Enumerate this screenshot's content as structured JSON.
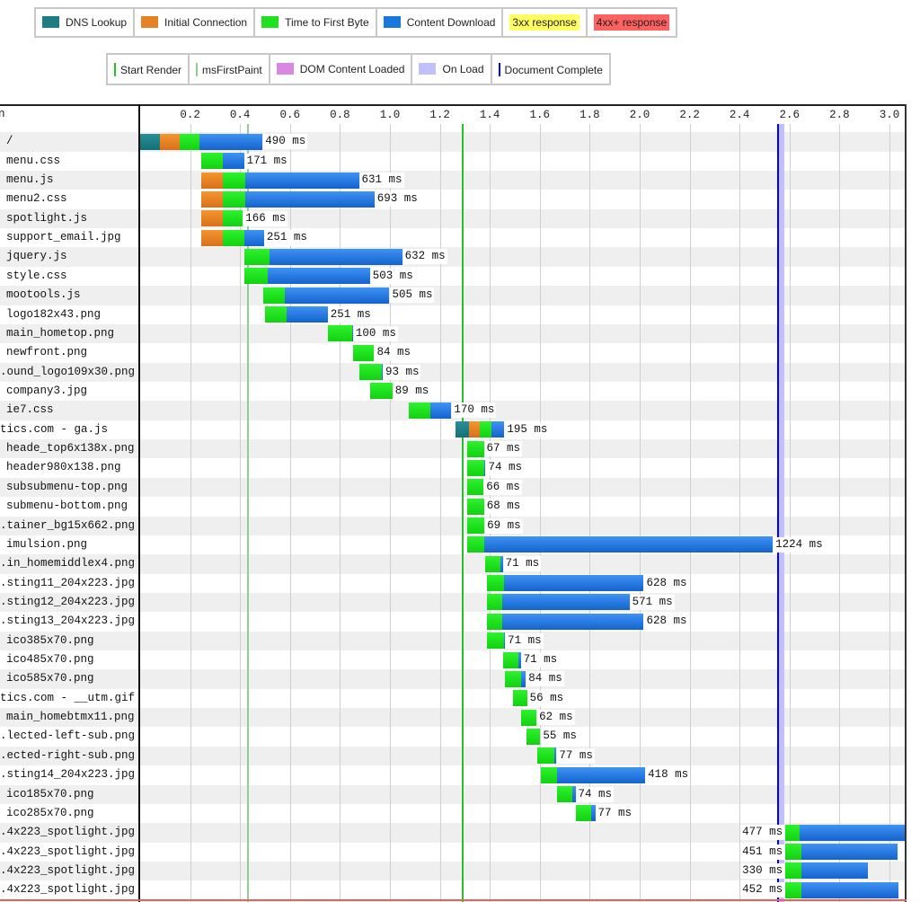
{
  "legend": {
    "request_phases": [
      {
        "label": "DNS Lookup",
        "color": "#1f7c83",
        "style": "swatch"
      },
      {
        "label": "Initial Connection",
        "color": "#e58226",
        "style": "swatch"
      },
      {
        "label": "Time to First Byte",
        "color": "#1fe11f",
        "style": "swatch"
      },
      {
        "label": "Content Download",
        "color": "#1977dd",
        "style": "swatch"
      },
      {
        "label": "3xx response",
        "color": "#ffff60",
        "style": "highlight"
      },
      {
        "label": "4xx+ response",
        "color": "#ff6060",
        "style": "highlight"
      }
    ],
    "page_events": [
      {
        "label": "Start Render",
        "color": "#28c028",
        "style": "line"
      },
      {
        "label": "msFirstPaint",
        "color": "#8fcf8f",
        "style": "line"
      },
      {
        "label": "DOM Content Loaded",
        "color": "#d888e0",
        "style": "swatch"
      },
      {
        "label": "On Load",
        "color": "#c0c0ff",
        "style": "swatch"
      },
      {
        "label": "Document Complete",
        "color": "#0000ff",
        "style": "line"
      }
    ]
  },
  "chart_data": {
    "type": "bar",
    "variant": "waterfall",
    "title": "",
    "column_header": "n",
    "xlabel": "",
    "x_unit": "seconds",
    "xlim": [
      0,
      3.065
    ],
    "xticks": [
      0.2,
      0.4,
      0.6,
      0.8,
      1.0,
      1.2,
      1.4,
      1.6,
      1.8,
      2.0,
      2.2,
      2.4,
      2.6,
      2.8,
      3.0
    ],
    "tick_labels": [
      "0.2",
      "0.4",
      "0.6",
      "0.8",
      "1.0",
      "1.2",
      "1.4",
      "1.6",
      "1.8",
      "2.0",
      "2.2",
      "2.4",
      "2.6",
      "2.8",
      "3.0"
    ],
    "grid": true,
    "series": [
      {
        "key": "dns",
        "name": "DNS Lookup",
        "color": "#1f7c83"
      },
      {
        "key": "connect",
        "name": "Initial Connection",
        "color": "#e58226"
      },
      {
        "key": "ttfb",
        "name": "Time to First Byte",
        "color": "#1fe11f"
      },
      {
        "key": "download",
        "name": "Content Download",
        "color": "#1977dd"
      }
    ],
    "requests": [
      {
        "name": "/",
        "truncated": false,
        "start_s": 0.0,
        "dns": 80,
        "connect": 78,
        "ttfb": 80,
        "download": 252,
        "label": "490 ms"
      },
      {
        "name": "menu.css",
        "truncated": false,
        "start_s": 0.245,
        "dns": 0,
        "connect": 0,
        "ttfb": 86,
        "download": 85,
        "label": "171 ms"
      },
      {
        "name": "menu.js",
        "truncated": false,
        "start_s": 0.245,
        "dns": 0,
        "connect": 86,
        "ttfb": 90,
        "download": 455,
        "label": "631 ms"
      },
      {
        "name": "menu2.css",
        "truncated": false,
        "start_s": 0.245,
        "dns": 0,
        "connect": 86,
        "ttfb": 90,
        "download": 517,
        "label": "693 ms"
      },
      {
        "name": "spotlight.js",
        "truncated": false,
        "start_s": 0.245,
        "dns": 0,
        "connect": 86,
        "ttfb": 80,
        "download": 0,
        "label": "166 ms"
      },
      {
        "name": "support_email.jpg",
        "truncated": false,
        "start_s": 0.245,
        "dns": 0,
        "connect": 86,
        "ttfb": 86,
        "download": 79,
        "label": "251 ms"
      },
      {
        "name": "jquery.js",
        "truncated": false,
        "start_s": 0.417,
        "dns": 0,
        "connect": 0,
        "ttfb": 100,
        "download": 532,
        "label": "632 ms"
      },
      {
        "name": "style.css",
        "truncated": false,
        "start_s": 0.417,
        "dns": 0,
        "connect": 0,
        "ttfb": 94,
        "download": 409,
        "label": "503 ms"
      },
      {
        "name": "mootools.js",
        "truncated": false,
        "start_s": 0.493,
        "dns": 0,
        "connect": 0,
        "ttfb": 86,
        "download": 419,
        "label": "505 ms"
      },
      {
        "name": "logo182x43.png",
        "truncated": false,
        "start_s": 0.5,
        "dns": 0,
        "connect": 0,
        "ttfb": 86,
        "download": 165,
        "label": "251 ms"
      },
      {
        "name": "main_hometop.png",
        "truncated": false,
        "start_s": 0.752,
        "dns": 0,
        "connect": 0,
        "ttfb": 96,
        "download": 4,
        "label": "100 ms"
      },
      {
        "name": "newfront.png",
        "truncated": false,
        "start_s": 0.853,
        "dns": 0,
        "connect": 0,
        "ttfb": 84,
        "download": 0,
        "label": "84 ms"
      },
      {
        "name": ".ound_logo109x30.png",
        "truncated": true,
        "start_s": 0.878,
        "dns": 0,
        "connect": 0,
        "ttfb": 91,
        "download": 2,
        "label": "93 ms"
      },
      {
        "name": "company3.jpg",
        "truncated": false,
        "start_s": 0.921,
        "dns": 0,
        "connect": 0,
        "ttfb": 89,
        "download": 0,
        "label": "89 ms"
      },
      {
        "name": "ie7.css",
        "truncated": false,
        "start_s": 1.076,
        "dns": 0,
        "connect": 0,
        "ttfb": 86,
        "download": 84,
        "label": "170 ms"
      },
      {
        "name": "tics.com - ga.js",
        "truncated": true,
        "start_s": 1.263,
        "dns": 54,
        "connect": 43,
        "ttfb": 47,
        "download": 51,
        "label": "195 ms"
      },
      {
        "name": "heade_top6x138x.png",
        "truncated": false,
        "start_s": 1.309,
        "dns": 0,
        "connect": 0,
        "ttfb": 67,
        "download": 0,
        "label": "67 ms"
      },
      {
        "name": "header980x138.png",
        "truncated": false,
        "start_s": 1.309,
        "dns": 0,
        "connect": 0,
        "ttfb": 70,
        "download": 4,
        "label": "74 ms"
      },
      {
        "name": "subsubmenu-top.png",
        "truncated": false,
        "start_s": 1.309,
        "dns": 0,
        "connect": 0,
        "ttfb": 66,
        "download": 0,
        "label": "66 ms"
      },
      {
        "name": "submenu-bottom.png",
        "truncated": false,
        "start_s": 1.309,
        "dns": 0,
        "connect": 0,
        "ttfb": 68,
        "download": 0,
        "label": "68 ms"
      },
      {
        "name": ".tainer_bg15x662.png",
        "truncated": true,
        "start_s": 1.309,
        "dns": 0,
        "connect": 0,
        "ttfb": 69,
        "download": 0,
        "label": "69 ms"
      },
      {
        "name": "imulsion.png",
        "truncated": false,
        "start_s": 1.309,
        "dns": 0,
        "connect": 0,
        "ttfb": 68,
        "download": 1156,
        "label": "1224 ms"
      },
      {
        "name": ".in_homemiddlex4.png",
        "truncated": true,
        "start_s": 1.381,
        "dns": 0,
        "connect": 0,
        "ttfb": 61,
        "download": 10,
        "label": "71 ms"
      },
      {
        "name": ".sting11_204x223.jpg",
        "truncated": true,
        "start_s": 1.388,
        "dns": 0,
        "connect": 0,
        "ttfb": 68,
        "download": 560,
        "label": "628 ms"
      },
      {
        "name": ".sting12_204x223.jpg",
        "truncated": true,
        "start_s": 1.388,
        "dns": 0,
        "connect": 0,
        "ttfb": 61,
        "download": 510,
        "label": "571 ms"
      },
      {
        "name": ".sting13_204x223.jpg",
        "truncated": true,
        "start_s": 1.388,
        "dns": 0,
        "connect": 0,
        "ttfb": 61,
        "download": 567,
        "label": "628 ms"
      },
      {
        "name": "ico385x70.png",
        "truncated": false,
        "start_s": 1.39,
        "dns": 0,
        "connect": 0,
        "ttfb": 68,
        "download": 3,
        "label": "71 ms"
      },
      {
        "name": "ico485x70.png",
        "truncated": false,
        "start_s": 1.453,
        "dns": 0,
        "connect": 0,
        "ttfb": 61,
        "download": 10,
        "label": "71 ms"
      },
      {
        "name": "ico585x70.png",
        "truncated": false,
        "start_s": 1.46,
        "dns": 0,
        "connect": 0,
        "ttfb": 65,
        "download": 19,
        "label": "84 ms"
      },
      {
        "name": "tics.com - __utm.gif",
        "truncated": true,
        "start_s": 1.493,
        "dns": 0,
        "connect": 0,
        "ttfb": 56,
        "download": 0,
        "label": "56 ms"
      },
      {
        "name": "main_homebtmx11.png",
        "truncated": false,
        "start_s": 1.525,
        "dns": 0,
        "connect": 0,
        "ttfb": 62,
        "download": 0,
        "label": "62 ms"
      },
      {
        "name": ".lected-left-sub.png",
        "truncated": true,
        "start_s": 1.547,
        "dns": 0,
        "connect": 0,
        "ttfb": 55,
        "download": 0,
        "label": "55 ms"
      },
      {
        "name": ".ected-right-sub.png",
        "truncated": true,
        "start_s": 1.59,
        "dns": 0,
        "connect": 0,
        "ttfb": 68,
        "download": 9,
        "label": "77 ms"
      },
      {
        "name": ".sting14_204x223.jpg",
        "truncated": true,
        "start_s": 1.604,
        "dns": 0,
        "connect": 0,
        "ttfb": 65,
        "download": 353,
        "label": "418 ms"
      },
      {
        "name": "ico185x70.png",
        "truncated": false,
        "start_s": 1.669,
        "dns": 0,
        "connect": 0,
        "ttfb": 61,
        "download": 13,
        "label": "74 ms"
      },
      {
        "name": "ico285x70.png",
        "truncated": false,
        "start_s": 1.745,
        "dns": 0,
        "connect": 0,
        "ttfb": 61,
        "download": 16,
        "label": "77 ms"
      },
      {
        "name": ".4x223_spotlight.jpg",
        "truncated": true,
        "start_s": 2.583,
        "dns": 0,
        "connect": 0,
        "ttfb": 58,
        "download": 419,
        "label": "477 ms"
      },
      {
        "name": ".4x223_spotlight.jpg",
        "truncated": true,
        "start_s": 2.583,
        "dns": 0,
        "connect": 0,
        "ttfb": 65,
        "download": 386,
        "label": "451 ms"
      },
      {
        "name": ".4x223_spotlight.jpg",
        "truncated": true,
        "start_s": 2.583,
        "dns": 0,
        "connect": 0,
        "ttfb": 65,
        "download": 265,
        "label": "330 ms"
      },
      {
        "name": ".4x223_spotlight.jpg",
        "truncated": true,
        "start_s": 2.583,
        "dns": 0,
        "connect": 0,
        "ttfb": 65,
        "download": 387,
        "label": "452 ms"
      }
    ],
    "events": [
      {
        "key": "ms-first-paint",
        "name": "msFirstPaint",
        "start_s": 0.432,
        "end_s": 0.432,
        "color": "#8fcf8f"
      },
      {
        "key": "start-render",
        "name": "Start Render",
        "start_s": 1.291,
        "end_s": 1.291,
        "color": "#28c028"
      },
      {
        "key": "on-load",
        "name": "On Load",
        "start_s": 2.561,
        "end_s": 2.583,
        "color": "#c0c0ff"
      },
      {
        "key": "document-complete",
        "name": "Document Complete",
        "start_s": 2.554,
        "end_s": 2.554,
        "color": "#0000ff"
      }
    ]
  }
}
